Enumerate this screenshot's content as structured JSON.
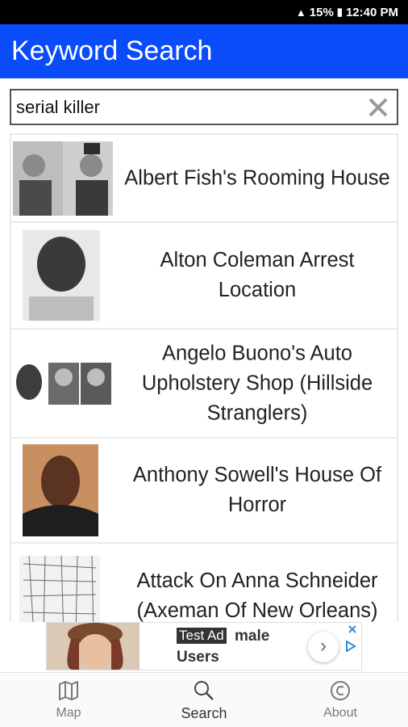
{
  "status_bar": {
    "battery": "15%",
    "time": "12:40 PM"
  },
  "app_bar": {
    "title": "Keyword Search"
  },
  "search": {
    "value": "serial killer",
    "placeholder": ""
  },
  "results": [
    {
      "label": "Albert Fish's Rooming House"
    },
    {
      "label": "Alton Coleman Arrest Location"
    },
    {
      "label": "Angelo Buono's Auto Upholstery Shop (Hillside Stranglers)"
    },
    {
      "label": "Anthony Sowell's House Of Horror"
    },
    {
      "label": "Attack On Anna Schneider (Axeman Of New Orleans)"
    }
  ],
  "ad": {
    "test_label": "Test Ad",
    "line1_rest": "male",
    "line2": "Users"
  },
  "bottom_nav": [
    {
      "label": "Map",
      "icon": "map-icon"
    },
    {
      "label": "Search",
      "icon": "search-icon"
    },
    {
      "label": "About",
      "icon": "copyright-icon"
    }
  ],
  "colors": {
    "app_bar": "#0a4bfa",
    "status_bar": "#000000"
  }
}
